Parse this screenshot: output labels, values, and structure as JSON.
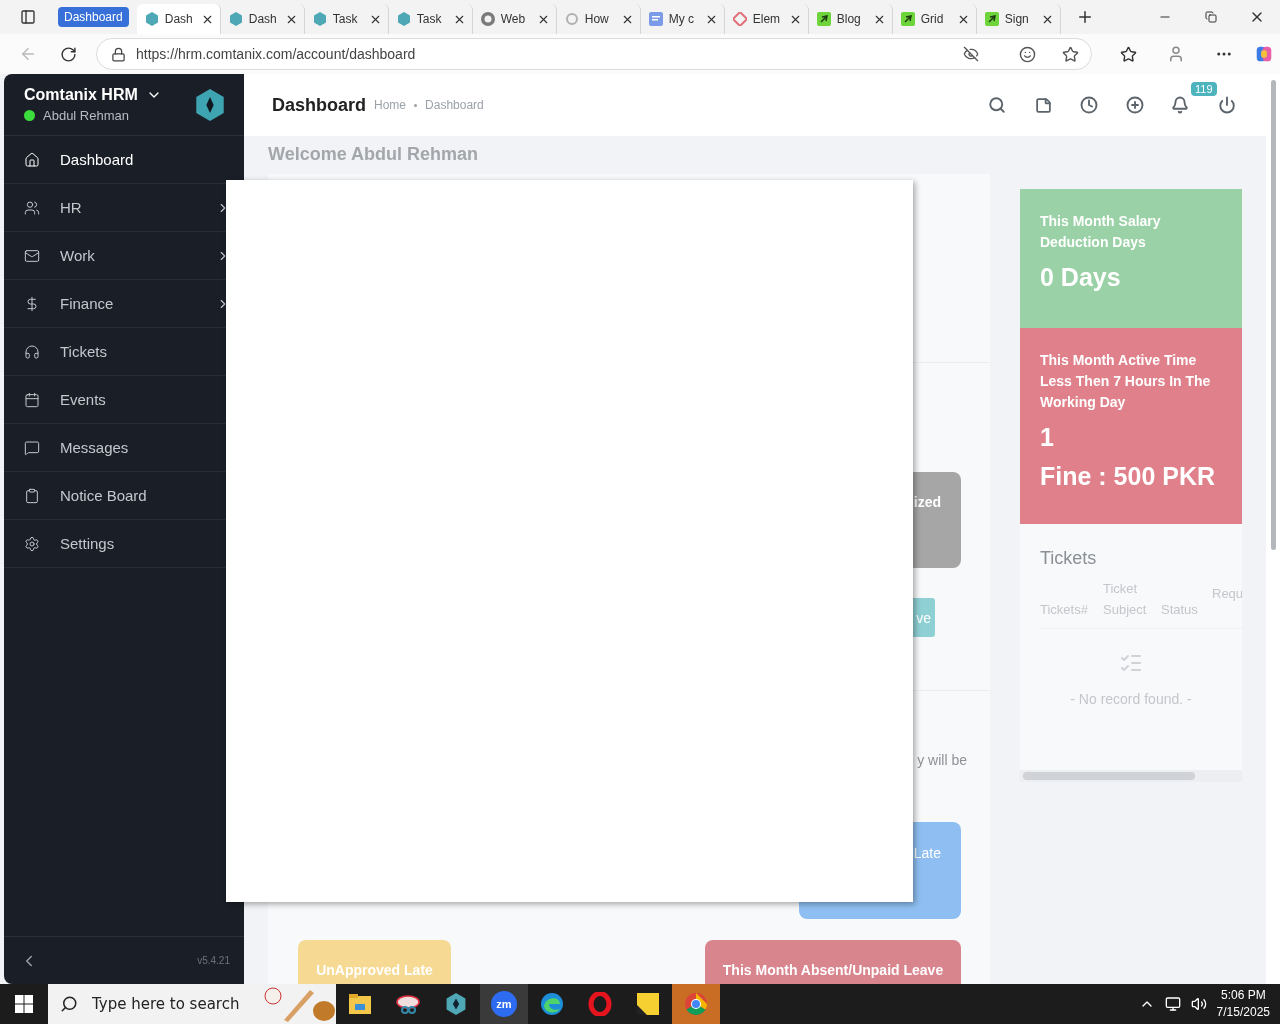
{
  "browser": {
    "tab_group": {
      "label": "Dashboard"
    },
    "tabs": [
      {
        "title": "Dash",
        "selected": true,
        "kind": "hex"
      },
      {
        "title": "Dash",
        "selected": false,
        "kind": "hex"
      },
      {
        "title": "Task",
        "selected": false,
        "kind": "hex"
      },
      {
        "title": "Task",
        "selected": false,
        "kind": "hex"
      },
      {
        "title": "Web",
        "selected": false,
        "kind": "circle"
      },
      {
        "title": "How",
        "selected": false,
        "kind": "google"
      },
      {
        "title": "My c",
        "selected": false,
        "kind": "doc"
      },
      {
        "title": "Elem",
        "selected": false,
        "kind": "diamond"
      },
      {
        "title": "Blog",
        "selected": false,
        "kind": "leaf"
      },
      {
        "title": "Grid",
        "selected": false,
        "kind": "leaf"
      },
      {
        "title": "Sign",
        "selected": false,
        "kind": "leaf"
      }
    ],
    "url": "https://hrm.comtanix.com/account/dashboard"
  },
  "sidebar": {
    "brand": "Comtanix HRM",
    "user": {
      "name": "Abdul Rehman",
      "online": true
    },
    "items": [
      {
        "label": "Dashboard",
        "selected": true,
        "expandable": false
      },
      {
        "label": "HR",
        "selected": false,
        "expandable": true
      },
      {
        "label": "Work",
        "selected": false,
        "expandable": true
      },
      {
        "label": "Finance",
        "selected": false,
        "expandable": true
      },
      {
        "label": "Tickets",
        "selected": false,
        "expandable": false
      },
      {
        "label": "Events",
        "selected": false,
        "expandable": false
      },
      {
        "label": "Messages",
        "selected": false,
        "expandable": false
      },
      {
        "label": "Notice Board",
        "selected": false,
        "expandable": false
      },
      {
        "label": "Settings",
        "selected": false,
        "expandable": false
      }
    ],
    "version": "v5.4.21"
  },
  "header": {
    "title": "Dashboard",
    "breadcrumb": [
      "Home",
      "Dashboard"
    ],
    "notification_count": "119"
  },
  "welcome": "Welcome Abdul Rehman",
  "panel": {
    "status_card": "ized",
    "action_button": "ve",
    "note": "y will be",
    "late_card": "Late",
    "bottom_cards": [
      {
        "label": "UnApproved Late",
        "color": "#f6da94"
      },
      {
        "label": "This Month Absent/Unpaid Leave",
        "color": "#d9858e"
      }
    ]
  },
  "stats": [
    {
      "kind": "days",
      "title": "This Month Salary Deduction Days",
      "value": "0 Days",
      "color": "#9bd1a6"
    },
    {
      "kind": "fine",
      "title": "This Month Active Time Less Then 7 Hours In The Working Day",
      "value": "1",
      "fine": "Fine : 500 PKR",
      "color": "#e0808b"
    }
  ],
  "tickets": {
    "title": "Tickets",
    "columns": [
      "Tickets#",
      "Ticket Subject",
      "Status",
      "Requ"
    ],
    "empty": "- No record found. -"
  },
  "taskbar": {
    "search_placeholder": "Type here to search",
    "apps": [
      {
        "kind": "folder",
        "hover": false,
        "flashing": false
      },
      {
        "kind": "tool",
        "hover": false,
        "flashing": false
      },
      {
        "kind": "hex",
        "hover": false,
        "flashing": false
      },
      {
        "kind": "zoom",
        "label": "zm",
        "hover": true,
        "flashing": false
      },
      {
        "kind": "edge",
        "hover": false,
        "flashing": false
      },
      {
        "kind": "opera",
        "hover": false,
        "flashing": false
      },
      {
        "kind": "sticky",
        "hover": false,
        "flashing": false
      },
      {
        "kind": "chrome",
        "hover": false,
        "flashing": true
      }
    ],
    "time": "5:06 PM",
    "date": "7/15/2025"
  }
}
